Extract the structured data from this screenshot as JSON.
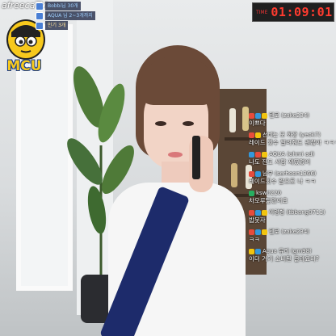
{
  "brand": {
    "logo_text": "afreecaTV",
    "mascot_text": "MCU"
  },
  "info_panel": {
    "rows": [
      {
        "text": "Bobbi님 30개",
        "style": "cool"
      },
      {
        "text": "AQUA 님 2~3개까지",
        "style": "cool"
      },
      {
        "text": "인기 3개",
        "style": "warm"
      }
    ]
  },
  "timer": {
    "label": "TIME",
    "value": "01:09:01"
  },
  "chat": {
    "messages": [
      {
        "nick": "텐로 (zake234)",
        "text": "이쁘다",
        "badges": [
          "#e74c3c",
          "#3498db",
          "#f1c40f"
        ]
      },
      {
        "nick": "선비는 모 화장 (yeok7)",
        "text": "레이드 횟수 알려줘도 괜찮아 ㅋㅋㅋ",
        "badges": [
          "#e74c3c",
          "#f1c40f"
        ]
      },
      {
        "nick": "AQUA (ohmi ad)",
        "text": "나도 진도 사람 쟤였었어",
        "badges": [
          "#3498db",
          "#e74c3c",
          "#f1c40f"
        ]
      },
      {
        "nick": "남부 (serhoon1366)",
        "text": "레이드횟수 알으로 나 ㅋㅋ",
        "badges": [
          "#e74c3c",
          "#3498db"
        ]
      },
      {
        "nick": "ksw0220",
        "text": "차오루닮았어요",
        "badges": [
          "#27ae60"
        ]
      },
      {
        "nick": "아령형 (tbbang0711)",
        "text": "밥뭇자",
        "badges": [
          "#e74c3c",
          "#3498db",
          "#f1c40f"
        ]
      },
      {
        "nick": "텐로 (zake234)",
        "text": "ㅋㅋ",
        "badges": [
          "#e74c3c",
          "#3498db",
          "#f1c40f"
        ]
      },
      {
        "nick": "Aqua 뮤리 (gm98)",
        "text": "이더 거기 소비된 결과요다?",
        "badges": [
          "#f1c40f",
          "#3498db"
        ]
      }
    ]
  }
}
